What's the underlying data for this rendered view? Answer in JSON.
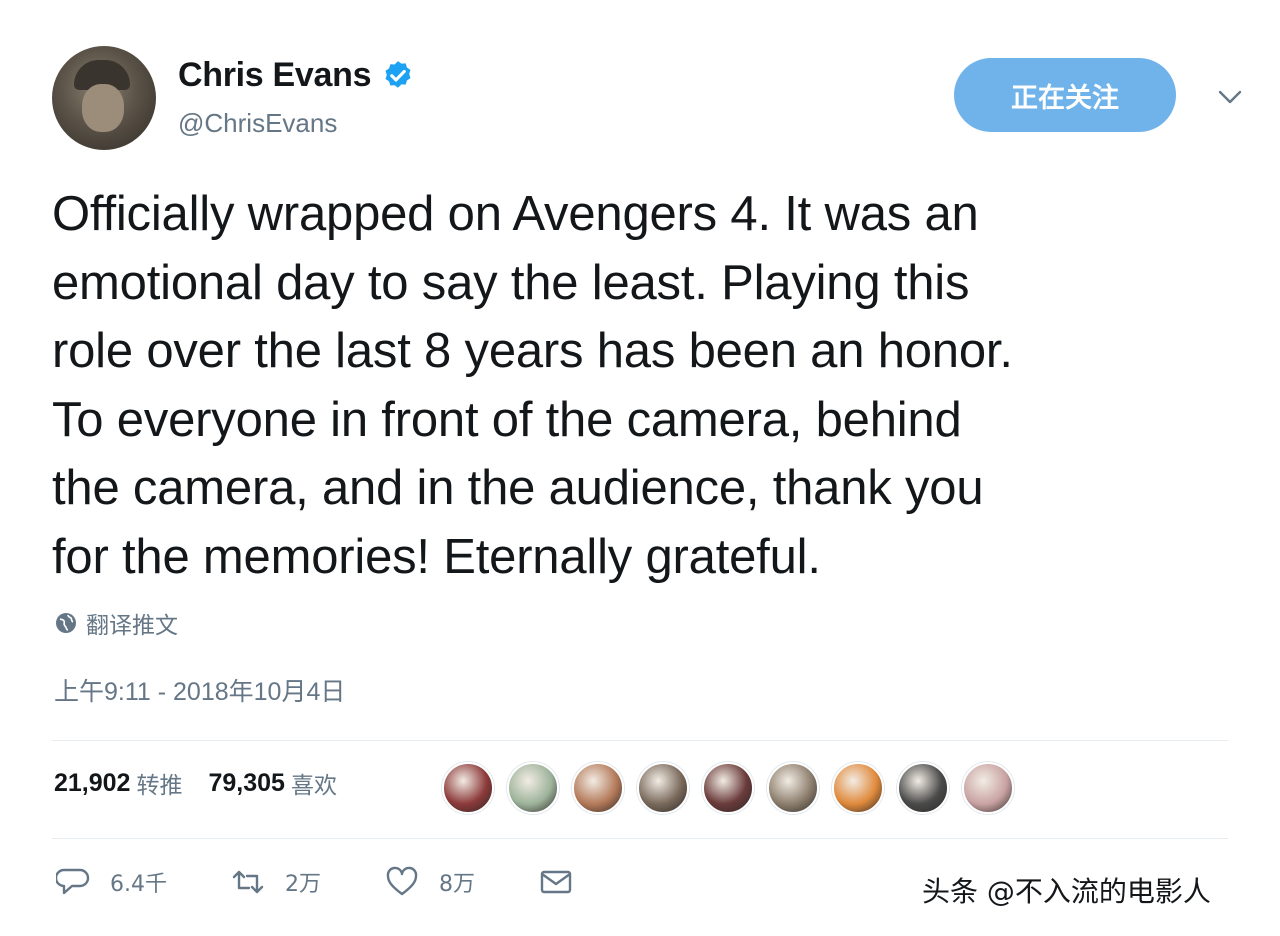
{
  "author": {
    "display_name": "Chris Evans",
    "handle": "@ChrisEvans",
    "verified": true
  },
  "follow_button": {
    "label": "正在关注"
  },
  "tweet": {
    "text": "Officially wrapped on Avengers 4. It was an\nemotional day to say the least. Playing this\nrole over the last 8 years has been an honor.\nTo everyone in front of the camera, behind\nthe camera, and in the audience, thank you\nfor the memories! Eternally grateful.",
    "translate_label": "翻译推文",
    "timestamp": "上午9:11 - 2018年10月4日"
  },
  "stats": {
    "retweets_count": "21,902",
    "retweets_label": "转推",
    "likes_count": "79,305",
    "likes_label": "喜欢"
  },
  "likers": [
    {
      "color": "#8c3a3a"
    },
    {
      "color": "#9db39a"
    },
    {
      "color": "#b47a5a"
    },
    {
      "color": "#7a6a5c"
    },
    {
      "color": "#6a3b3b"
    },
    {
      "color": "#8d7f6e"
    },
    {
      "color": "#e08a3c"
    },
    {
      "color": "#4a4a4a"
    },
    {
      "color": "#c9a3a3"
    }
  ],
  "actions": {
    "reply_count": "6.4千",
    "retweet_count": "2万",
    "like_count": "8万"
  },
  "icons": {
    "reply": "reply-icon",
    "retweet": "retweet-icon",
    "like": "heart-icon",
    "message": "mail-icon",
    "verified": "verified-badge-icon",
    "more": "chevron-down-icon",
    "globe": "globe-icon"
  },
  "colors": {
    "follow_button": "#6fb3ea",
    "secondary_text": "#657786",
    "verified": "#1da1f2"
  },
  "watermark": "头条 @不入流的电影人"
}
